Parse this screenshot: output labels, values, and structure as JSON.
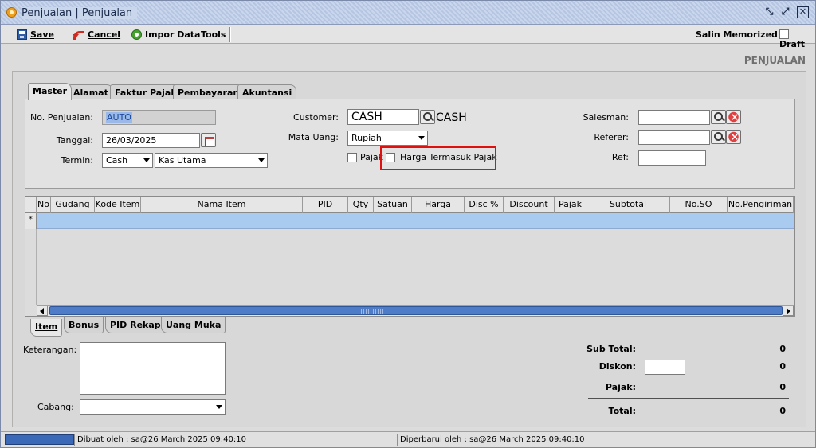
{
  "window": {
    "title": "Penjualan | Penjualan"
  },
  "toolbar": {
    "save_label": "Save",
    "cancel_label": "Cancel",
    "impor_label": "Impor Data",
    "tools_label": "Tools",
    "salin_label": "Salin Memorized",
    "draft_label": "Draft"
  },
  "page_heading": "PENJUALAN",
  "tabs": [
    "Master",
    "Alamat",
    "Faktur Pajak",
    "Pembayaran",
    "Akuntansi"
  ],
  "form": {
    "no_penjualan": {
      "label": "No. Penjualan:",
      "value": "AUTO"
    },
    "tanggal": {
      "label": "Tanggal:",
      "value": "26/03/2025"
    },
    "termin": {
      "label": "Termin:",
      "value": "Cash",
      "account": "Kas Utama"
    },
    "customer": {
      "label": "Customer:",
      "value": "CASH",
      "name": "CASH"
    },
    "mata_uang": {
      "label": "Mata Uang:",
      "value": "Rupiah"
    },
    "pajak_label": "Pajak",
    "harga_termasuk_pajak_label": "Harga Termasuk Pajak",
    "salesman": {
      "label": "Salesman:",
      "value": ""
    },
    "referer": {
      "label": "Referer:",
      "value": ""
    },
    "ref": {
      "label": "Ref:",
      "value": ""
    }
  },
  "grid": {
    "columns": [
      "No",
      "Gudang",
      "Kode Item",
      "Nama Item",
      "PID",
      "Qty",
      "Satuan",
      "Harga",
      "Disc %",
      "Discount",
      "Pajak",
      "Subtotal",
      "No.SO",
      "No.Pengiriman"
    ],
    "row_marker": "*"
  },
  "bottom_tabs": [
    "Item",
    "Bonus",
    "PID Rekap",
    "Uang Muka"
  ],
  "bottom": {
    "keterangan_label": "Keterangan:",
    "cabang_label": "Cabang:",
    "cabang_value": ""
  },
  "totals": {
    "sub_total": {
      "label": "Sub Total:",
      "value": "0"
    },
    "diskon": {
      "label": "Diskon:",
      "value": "0",
      "input": ""
    },
    "pajak": {
      "label": "Pajak:",
      "value": "0"
    },
    "total": {
      "label": "Total:",
      "value": "0"
    }
  },
  "status": {
    "dibuat": "Dibuat oleh : sa@26 March 2025  09:40:10",
    "diperbarui": "Diperbarui oleh : sa@26 March 2025  09:40:10"
  },
  "colors": {
    "highlight": "#e01010",
    "selection_row": "#a8cbef",
    "scroll_thumb": "#4f7cc6"
  }
}
